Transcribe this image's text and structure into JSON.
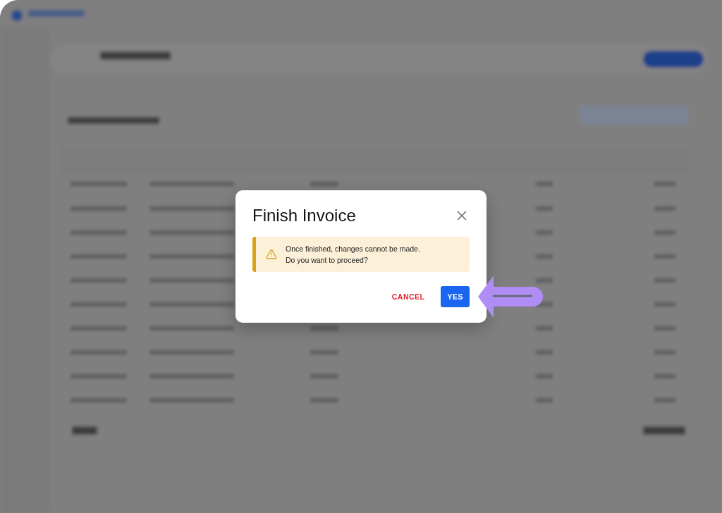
{
  "dialog": {
    "title": "Finish Invoice",
    "warning": {
      "lines": [
        "Once finished, changes cannot be made.",
        "Do you want to proceed?"
      ]
    },
    "buttons": [
      {
        "label": "CANCEL",
        "kind": "text"
      },
      {
        "label": "YES",
        "kind": "primary"
      }
    ]
  }
}
